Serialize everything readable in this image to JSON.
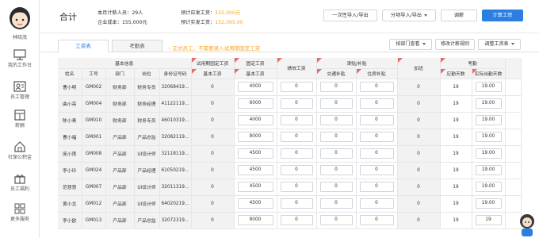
{
  "sidebar": {
    "user_name": "林晓茂",
    "items": [
      {
        "label": "我的工作台",
        "icon": "monitor-icon"
      },
      {
        "label": "员工管理",
        "icon": "people-icon"
      },
      {
        "label": "薪酬",
        "icon": "building-icon"
      },
      {
        "label": "社保公积金",
        "icon": "house-icon"
      },
      {
        "label": "员工福利",
        "icon": "gift-icon"
      },
      {
        "label": "更多服务",
        "icon": "grid-icon"
      }
    ],
    "active_index": 2
  },
  "header": {
    "title": "合计",
    "count_label": "本月计薪人员：",
    "count_value": "29人",
    "cost_label": "企业成本：",
    "cost_value": "155,000元",
    "expected_label": "预计应发工资：",
    "expected_value": "155,000元",
    "actual_label": "预计实发工资：",
    "actual_value": "152,065.00",
    "buttons": {
      "import_once": "一次性导入/导出",
      "import_split": "分项导入/导出",
      "adjust": "调薪",
      "calculate": "计算工资"
    }
  },
  "tabs": {
    "salary_tab": "工资表",
    "attendance_tab": "考勤表",
    "notice": "› 正式员工，不需要录入试用期固定工资",
    "dept_view": "按部门查看",
    "modify_rules": "修改计薪规则",
    "adjust_items": "调整工资表"
  },
  "table": {
    "group_headers": {
      "basic": "基本信息",
      "probation": "试用期固定工资",
      "fixed": "固定工资",
      "performance": "绩效工资",
      "allowance": "津贴/补贴",
      "overtime": "加班",
      "attendance": "考勤"
    },
    "columns": {
      "name": "姓名",
      "emp_id": "工号",
      "dept": "部门",
      "position": "岗位",
      "id_card": "身份证号码",
      "probation_base": "基本工资",
      "fixed_base": "基本工资",
      "transport": "交通补贴",
      "housing": "住房补贴",
      "due_days": "应勤天数",
      "actual_days": "实际出勤天数"
    },
    "rows": [
      {
        "name": "曹小明",
        "id": "GM002",
        "dept": "财务部",
        "pos": "财务专员",
        "idcard": "32068419...",
        "prob": "0",
        "base": "4000",
        "perf": "0",
        "trans": "0",
        "house": "0",
        "ot": "0",
        "due": "19",
        "actual": "19.00"
      },
      {
        "name": "曲小亮",
        "id": "GM004",
        "dept": "财务部",
        "pos": "财务经理",
        "idcard": "41122119...",
        "prob": "0",
        "base": "6000",
        "perf": "0",
        "trans": "0",
        "house": "0",
        "ot": "0",
        "due": "19",
        "actual": "19.00"
      },
      {
        "name": "陈小青",
        "id": "GM010",
        "dept": "财务部",
        "pos": "财务专员",
        "idcard": "46010319...",
        "prob": "0",
        "base": "4000",
        "perf": "0",
        "trans": "0",
        "house": "0",
        "ot": "0",
        "due": "19",
        "actual": "19.00"
      },
      {
        "name": "曹小福",
        "id": "GM001",
        "dept": "产品部",
        "pos": "产品总监",
        "idcard": "32082119...",
        "prob": "0",
        "base": "8000",
        "perf": "0",
        "trans": "0",
        "house": "0",
        "ot": "0",
        "due": "19",
        "actual": "19.00"
      },
      {
        "name": "庞小莲",
        "id": "GM008",
        "dept": "产品部",
        "pos": "UI设计师",
        "idcard": "32118119...",
        "prob": "0",
        "base": "4500",
        "perf": "0",
        "trans": "0",
        "house": "0",
        "ot": "0",
        "due": "19",
        "actual": "19.00"
      },
      {
        "name": "李小玲",
        "id": "GM024",
        "dept": "产品部",
        "pos": "产品经理",
        "idcard": "61050219...",
        "prob": "0",
        "base": "4500",
        "perf": "0",
        "trans": "0",
        "house": "0",
        "ot": "0",
        "due": "19",
        "actual": "19.00"
      },
      {
        "name": "范慧慧",
        "id": "GM007",
        "dept": "产品部",
        "pos": "UI设计师",
        "idcard": "32011319...",
        "prob": "0",
        "base": "4500",
        "perf": "0",
        "trans": "0",
        "house": "0",
        "ot": "0",
        "due": "19",
        "actual": "19.00"
      },
      {
        "name": "黄小龙",
        "id": "GM012",
        "dept": "产品部",
        "pos": "UI设计师",
        "idcard": "64020219...",
        "prob": "0",
        "base": "4500",
        "perf": "0",
        "trans": "0",
        "house": "0",
        "ot": "0",
        "due": "19",
        "actual": "19.00"
      },
      {
        "name": "李小欧",
        "id": "GM013",
        "dept": "产品部",
        "pos": "产品总监",
        "idcard": "32072319...",
        "prob": "0",
        "base": "8000",
        "perf": "0",
        "trans": "0",
        "house": "0",
        "ot": "0",
        "due": "19",
        "actual": "19"
      }
    ]
  }
}
